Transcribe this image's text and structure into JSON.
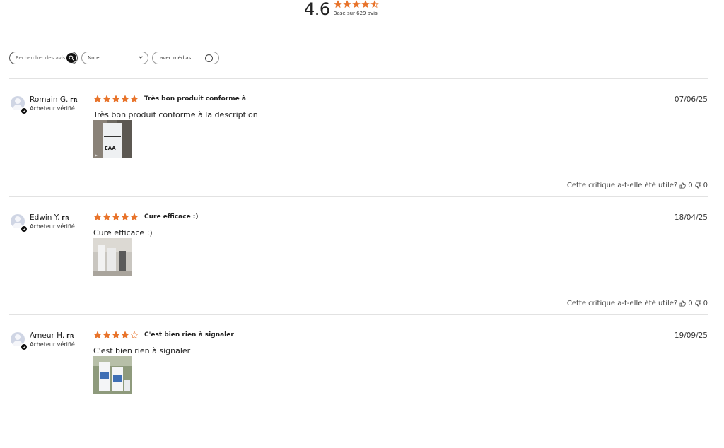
{
  "summary": {
    "average": "4.6",
    "rating": 4.6,
    "based_on": "Basé sur 629 avis"
  },
  "filters": {
    "search_placeholder": "Rechercher des avis",
    "rating_select": "Note",
    "media_toggle": "avec médias"
  },
  "reviews": [
    {
      "author": "Romain G.",
      "country": "FR",
      "verified": "Acheteur vérifié",
      "rating": 5,
      "title": "Très bon produit conforme à",
      "date": "07/06/25",
      "body": "Très bon produit conforme à la description",
      "helpful_text": "Cette critique a-t-elle été utile?",
      "up": "0",
      "down": "0"
    },
    {
      "author": "Edwin Y.",
      "country": "FR",
      "verified": "Acheteur vérifié",
      "rating": 5,
      "title": "Cure efficace :)",
      "date": "18/04/25",
      "body": "Cure efficace :)",
      "helpful_text": "Cette critique a-t-elle été utile?",
      "up": "0",
      "down": "0"
    },
    {
      "author": "Ameur H.",
      "country": "FR",
      "verified": "Acheteur vérifié",
      "rating": 4,
      "title": "C'est bien rien à signaler",
      "date": "19/09/25",
      "body": "C'est bien rien à signaler",
      "helpful_text": "Cette critique a-t-elle été utile?",
      "up": "0",
      "down": "0"
    }
  ],
  "colors": {
    "star": "#e8732a",
    "text": "#222222",
    "divider": "#e2e2e2"
  },
  "icons": {
    "search": "search-icon",
    "chevron": "chevron-down-icon",
    "thumbs_up": "thumbs-up-icon",
    "thumbs_down": "thumbs-down-icon",
    "verified": "check-icon",
    "avatar": "user-avatar-icon"
  }
}
